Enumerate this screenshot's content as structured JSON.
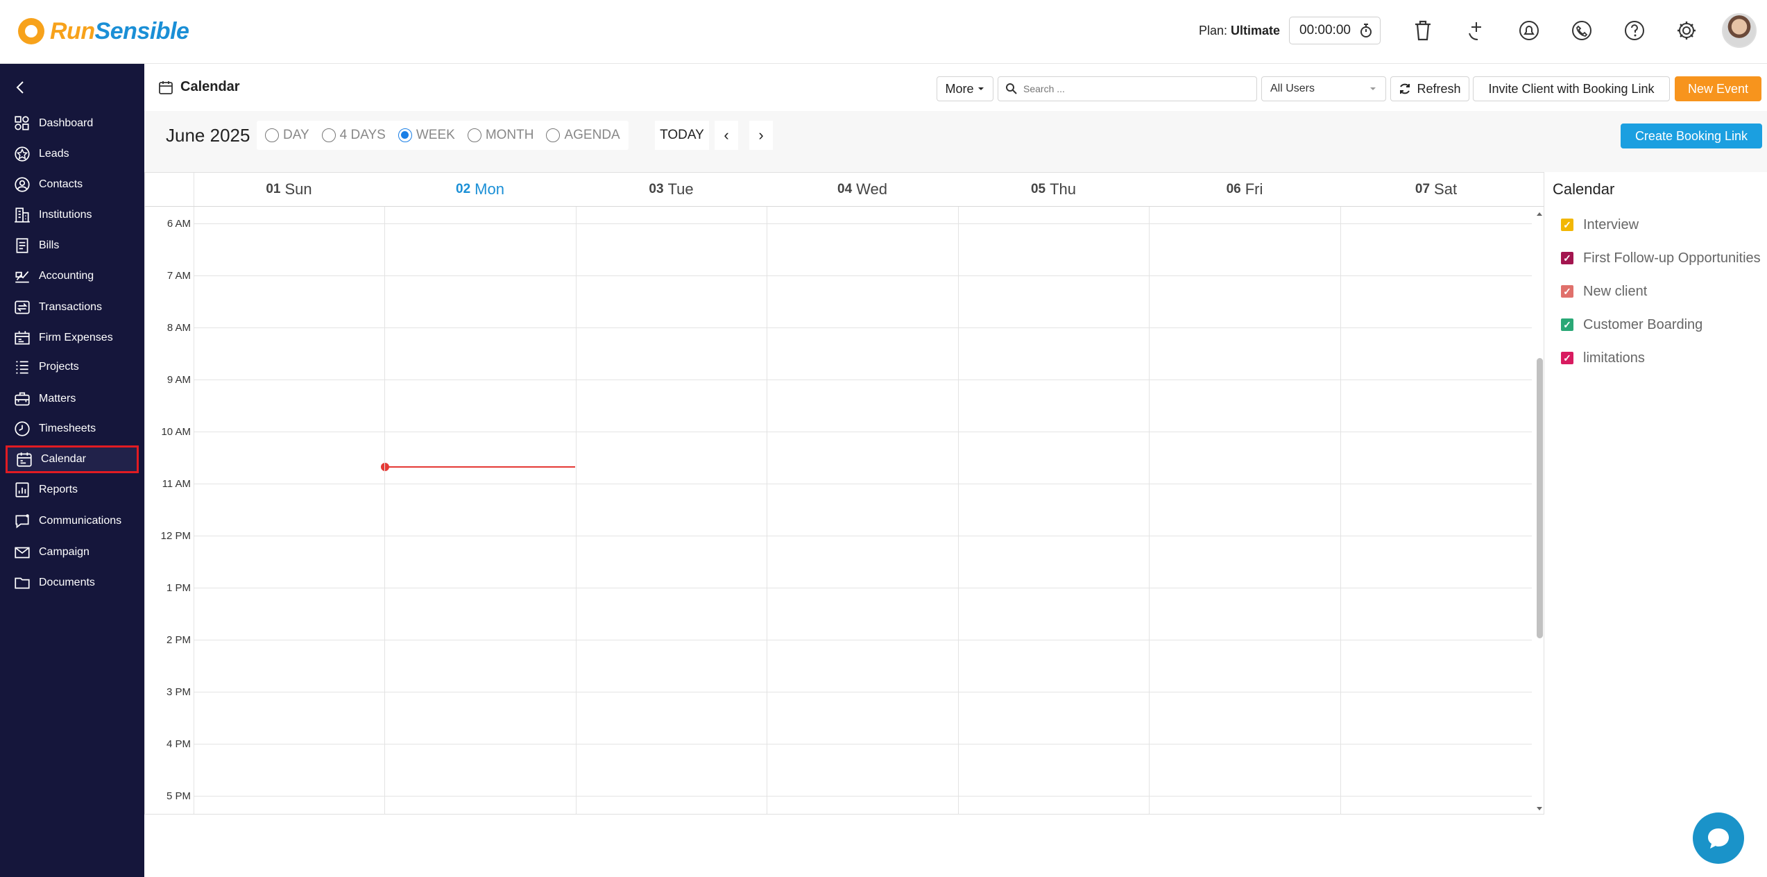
{
  "app": {
    "brand_run": "Run",
    "brand_sensible": "Sensible",
    "plan_label": "Plan:",
    "plan_value": "Ultimate",
    "timer": "00:00:00"
  },
  "top_icons": [
    "trash-icon",
    "phone-plus-icon",
    "bell-icon",
    "phone-icon",
    "help-icon",
    "gear-icon"
  ],
  "sidebar": {
    "items": [
      {
        "label": "Dashboard",
        "icon": "dashboard-icon"
      },
      {
        "label": "Leads",
        "icon": "star-icon"
      },
      {
        "label": "Contacts",
        "icon": "contact-icon"
      },
      {
        "label": "Institutions",
        "icon": "building-icon"
      },
      {
        "label": "Bills",
        "icon": "bill-icon"
      },
      {
        "label": "Accounting",
        "icon": "accounting-icon"
      },
      {
        "label": "Transactions",
        "icon": "transactions-icon"
      },
      {
        "label": "Firm Expenses",
        "icon": "expenses-icon"
      },
      {
        "label": "Projects",
        "icon": "projects-icon"
      },
      {
        "label": "Matters",
        "icon": "matters-icon"
      },
      {
        "label": "Timesheets",
        "icon": "clock-icon"
      },
      {
        "label": "Calendar",
        "icon": "calendar-icon",
        "active": true
      },
      {
        "label": "Reports",
        "icon": "reports-icon"
      },
      {
        "label": "Communications",
        "icon": "chat-icon"
      },
      {
        "label": "Campaign",
        "icon": "mail-icon"
      },
      {
        "label": "Documents",
        "icon": "folder-icon"
      }
    ]
  },
  "header": {
    "title": "Calendar",
    "more_label": "More",
    "search_placeholder": "Search ...",
    "users_select": "All Users",
    "refresh_label": "Refresh",
    "invite_label": "Invite Client with Booking Link",
    "new_event_label": "New Event"
  },
  "toolbar": {
    "month": "June 2025",
    "views": [
      {
        "label": "DAY",
        "selected": false
      },
      {
        "label": "4 DAYS",
        "selected": false
      },
      {
        "label": "WEEK",
        "selected": true
      },
      {
        "label": "MONTH",
        "selected": false
      },
      {
        "label": "AGENDA",
        "selected": false
      }
    ],
    "today_label": "TODAY",
    "prev_label": "‹",
    "next_label": "›",
    "create_booking_label": "Create Booking Link"
  },
  "week": {
    "days": [
      {
        "num": "01",
        "name": "Sun",
        "today": false
      },
      {
        "num": "02",
        "name": "Mon",
        "today": true
      },
      {
        "num": "03",
        "name": "Tue",
        "today": false
      },
      {
        "num": "04",
        "name": "Wed",
        "today": false
      },
      {
        "num": "05",
        "name": "Thu",
        "today": false
      },
      {
        "num": "06",
        "name": "Fri",
        "today": false
      },
      {
        "num": "07",
        "name": "Sat",
        "today": false
      }
    ],
    "hours": [
      "6 AM",
      "7 AM",
      "8 AM",
      "9 AM",
      "10 AM",
      "11 AM",
      "12 PM",
      "1 PM",
      "2 PM",
      "3 PM",
      "4 PM",
      "5 PM"
    ]
  },
  "legend": {
    "title": "Calendar",
    "items": [
      {
        "label": "Interview",
        "color": "#f2b705"
      },
      {
        "label": "First Follow-up Opportunities",
        "color": "#a3154f"
      },
      {
        "label": "New client",
        "color": "#e0706b"
      },
      {
        "label": "Customer Boarding",
        "color": "#2aa876"
      },
      {
        "label": "limitations",
        "color": "#d81b60"
      }
    ]
  },
  "colors": {
    "sidebar_bg": "#15163b",
    "accent_orange": "#f7941d",
    "accent_blue": "#1b9fe0",
    "now_line": "#e53935"
  }
}
